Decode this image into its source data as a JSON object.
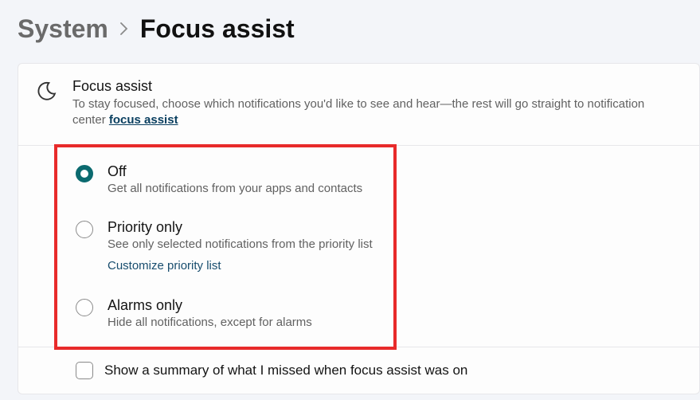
{
  "breadcrumb": {
    "parent": "System",
    "current": "Focus assist"
  },
  "header": {
    "title": "Focus assist",
    "description_prefix": "To stay focused, choose which notifications you'd like to see and hear—the rest will go straight to notification center ",
    "link_text": "focus assist"
  },
  "options": [
    {
      "label": "Off",
      "desc": "Get all notifications from your apps and contacts",
      "selected": true
    },
    {
      "label": "Priority only",
      "desc": "See only selected notifications from the priority list",
      "selected": false,
      "sublink": "Customize priority list"
    },
    {
      "label": "Alarms only",
      "desc": "Hide all notifications, except for alarms",
      "selected": false
    }
  ],
  "summary_checkbox": {
    "label": "Show a summary of what I missed when focus assist was on",
    "checked": false
  }
}
